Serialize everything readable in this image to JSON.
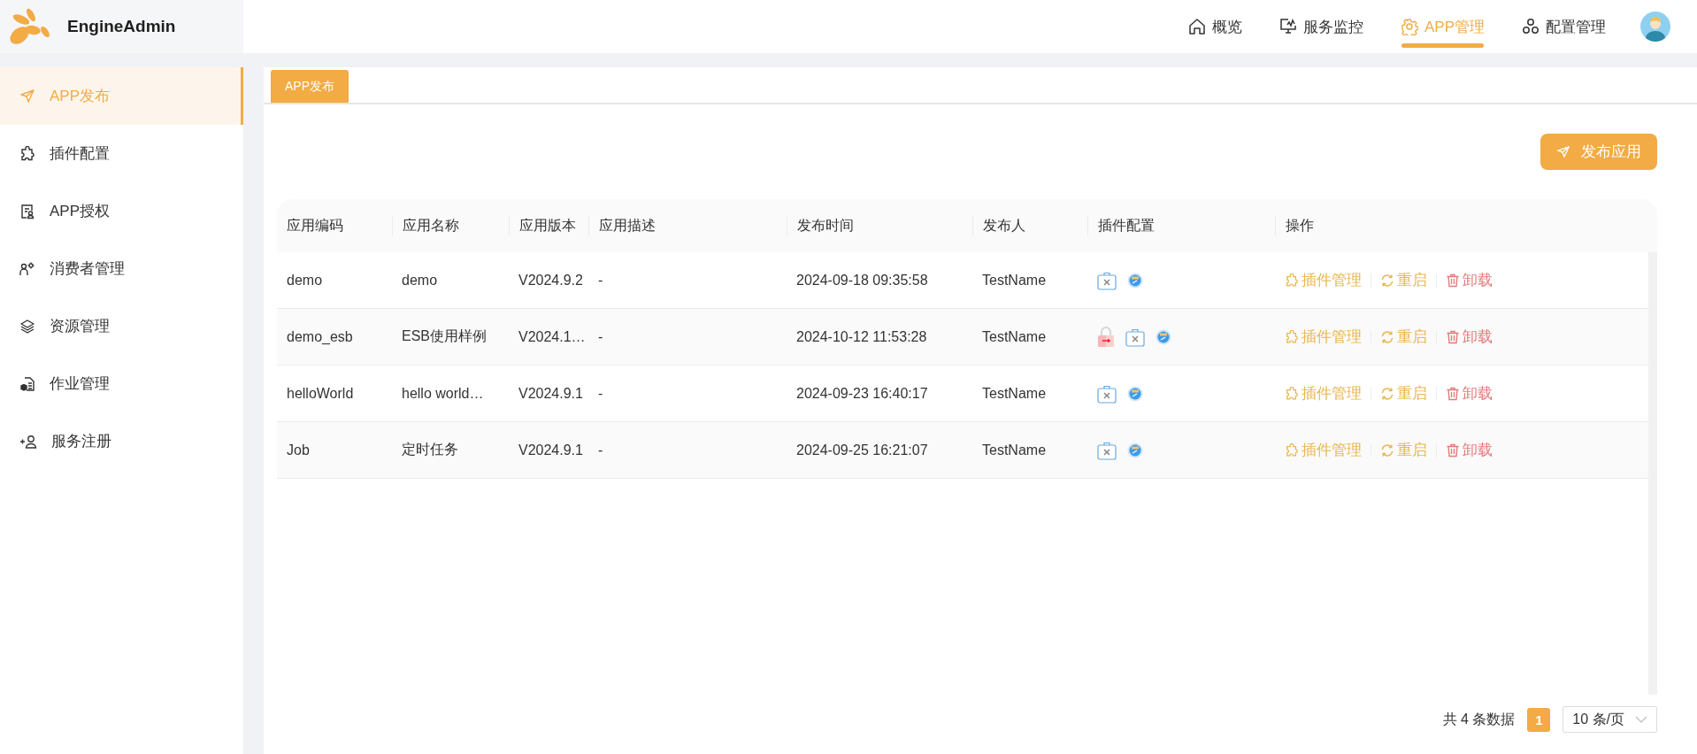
{
  "brand": {
    "name": "EngineAdmin"
  },
  "top_nav": [
    {
      "label": "概览",
      "selected": false
    },
    {
      "label": "服务监控",
      "selected": false
    },
    {
      "label": "APP管理",
      "selected": true
    },
    {
      "label": "配置管理",
      "selected": false
    }
  ],
  "sidebar": {
    "items": [
      {
        "label": "APP发布",
        "selected": true
      },
      {
        "label": "插件配置",
        "selected": false
      },
      {
        "label": "APP授权",
        "selected": false
      },
      {
        "label": "消费者管理",
        "selected": false
      },
      {
        "label": "资源管理",
        "selected": false
      },
      {
        "label": "作业管理",
        "selected": false
      },
      {
        "label": "服务注册",
        "selected": false
      }
    ]
  },
  "tabs": [
    {
      "label": "APP发布",
      "selected": true
    }
  ],
  "publish_button": "发布应用",
  "table": {
    "columns": [
      "应用编码",
      "应用名称",
      "应用版本",
      "应用描述",
      "发布时间",
      "发布人",
      "插件配置",
      "操作"
    ],
    "rows": [
      {
        "code": "demo",
        "name": "demo",
        "version": "V2024.9.2",
        "description": "-",
        "time": "2024-09-18 09:35:58",
        "publisher": "TestName",
        "plugins": [
          {
            "kind": "toolbox"
          },
          {
            "kind": "web"
          }
        ],
        "actions": [
          {
            "kind": "plugins",
            "label": "插件管理"
          },
          {
            "kind": "restart",
            "label": "重启"
          },
          {
            "kind": "uninstall",
            "label": "卸载"
          }
        ]
      },
      {
        "code": "demo_esb",
        "name": "ESB使用样例",
        "version": "V2024.1…",
        "description": "-",
        "time": "2024-10-12 11:53:28",
        "publisher": "TestName",
        "plugins": [
          {
            "kind": "lock"
          },
          {
            "kind": "toolbox"
          },
          {
            "kind": "web"
          }
        ],
        "actions": [
          {
            "kind": "plugins",
            "label": "插件管理"
          },
          {
            "kind": "restart",
            "label": "重启"
          },
          {
            "kind": "uninstall",
            "label": "卸载"
          }
        ]
      },
      {
        "code": "helloWorld",
        "name": "hello world…",
        "version": "V2024.9.1",
        "description": "-",
        "time": "2024-09-23 16:40:17",
        "publisher": "TestName",
        "plugins": [
          {
            "kind": "toolbox"
          },
          {
            "kind": "web"
          }
        ],
        "actions": [
          {
            "kind": "plugins",
            "label": "插件管理"
          },
          {
            "kind": "restart",
            "label": "重启"
          },
          {
            "kind": "uninstall",
            "label": "卸载"
          }
        ]
      },
      {
        "code": "Job",
        "name": "定时任务",
        "version": "V2024.9.1",
        "description": "-",
        "time": "2024-09-25 16:21:07",
        "publisher": "TestName",
        "plugins": [
          {
            "kind": "toolbox"
          },
          {
            "kind": "web"
          }
        ],
        "actions": [
          {
            "kind": "plugins",
            "label": "插件管理"
          },
          {
            "kind": "restart",
            "label": "重启"
          },
          {
            "kind": "uninstall",
            "label": "卸载"
          }
        ]
      }
    ]
  },
  "pagination": {
    "total": "共 4 条数据",
    "pages": [
      {
        "label": "1",
        "selected": true
      }
    ],
    "page_size": "10 条/页"
  }
}
